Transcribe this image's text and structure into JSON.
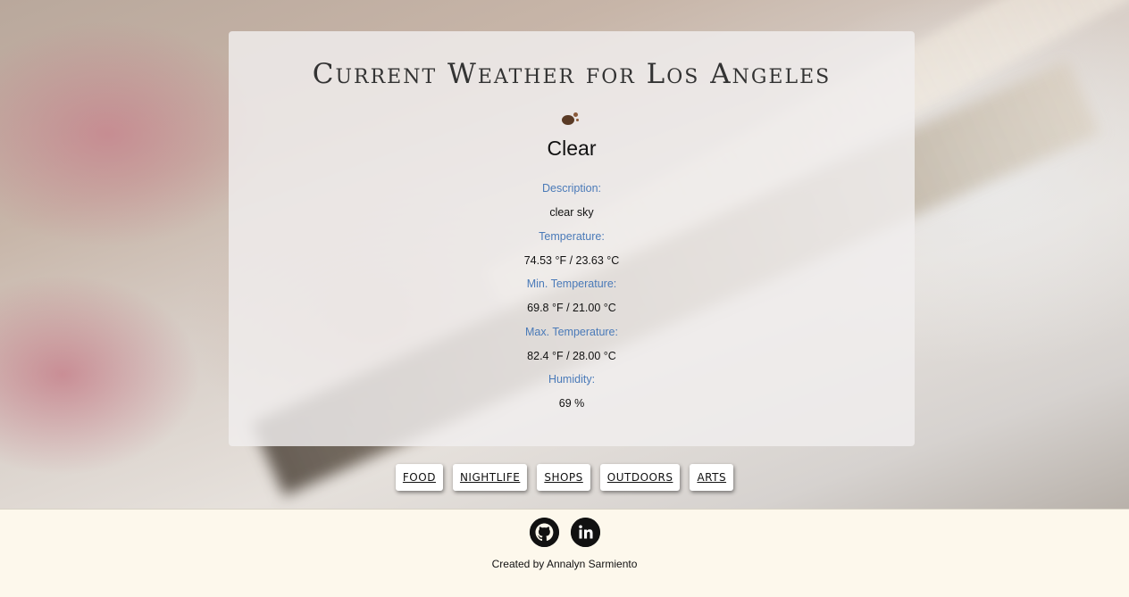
{
  "weather": {
    "title": "Current Weather for Los Angeles",
    "icon": "clear-sky-icon",
    "main": "Clear",
    "details": [
      {
        "label": "Description:",
        "value": "clear sky"
      },
      {
        "label": "Temperature:",
        "value": "74.53 °F / 23.63 °C"
      },
      {
        "label": "Min. Temperature:",
        "value": "69.8 °F / 21.00 °C"
      },
      {
        "label": "Max. Temperature:",
        "value": "82.4 °F / 28.00 °C"
      },
      {
        "label": "Humidity:",
        "value": "69 %"
      }
    ]
  },
  "categories": [
    "FOOD",
    "NIGHTLIFE",
    "SHOPS",
    "OUTDOORS",
    "ARTS"
  ],
  "footer": {
    "socials": [
      "github-icon",
      "linkedin-icon"
    ],
    "credit": "Created by Annalyn Sarmiento"
  },
  "colors": {
    "label_blue": "#4a7ab8",
    "footer_bg": "#fdf8ec",
    "card_bg": "#f0eeee"
  }
}
